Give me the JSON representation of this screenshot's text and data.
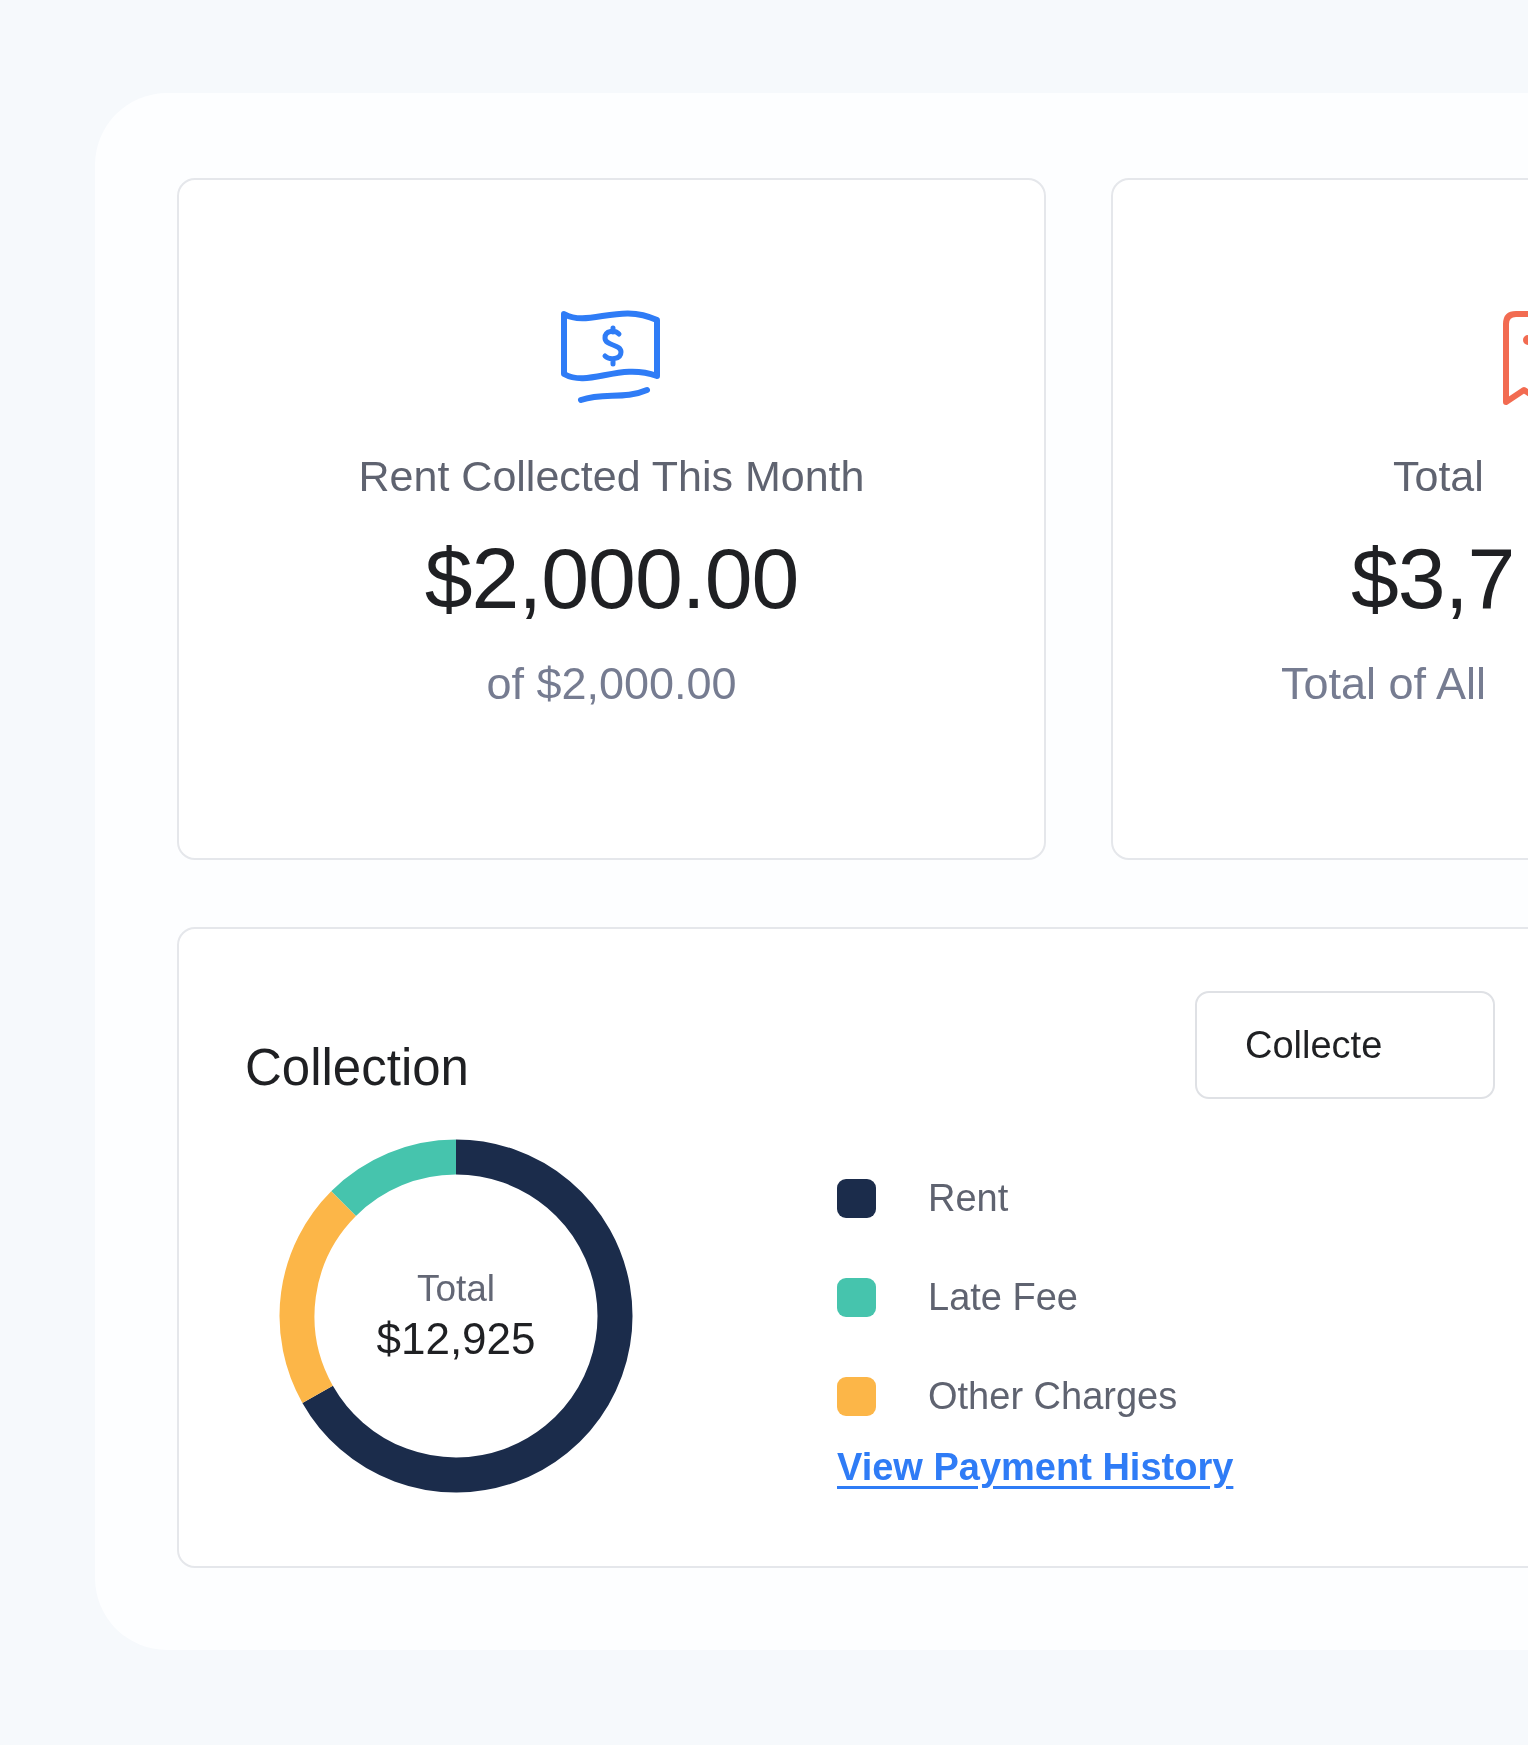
{
  "cards": [
    {
      "kind": "money",
      "title": "Rent Collected This Month",
      "amount": "$2,000.00",
      "subtitle": "of $2,000.00"
    },
    {
      "kind": "receipt",
      "title": "Total",
      "amount": "$3,7",
      "subtitle": "Total of All"
    }
  ],
  "collection": {
    "title": "Collection",
    "filter_button": "Collecte",
    "donut": {
      "label": "Total",
      "value": "$12,925"
    },
    "legend": [
      {
        "label": "Rent",
        "color": "#1b2c4b"
      },
      {
        "label": "Late Fee",
        "color": "#46c4ad"
      },
      {
        "label": "Other Charges",
        "color": "#fcb648"
      }
    ],
    "link": "View Payment History"
  }
}
